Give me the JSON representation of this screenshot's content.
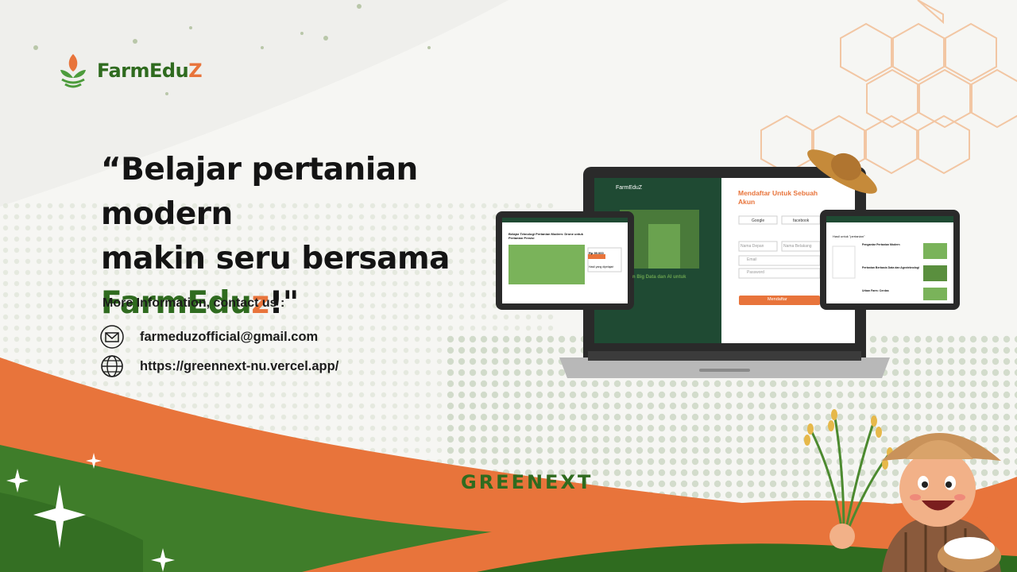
{
  "brand": {
    "name_main": "FarmEdu",
    "name_accent": "Z",
    "footer": "GREENEXT",
    "colors": {
      "green": "#2f6b1f",
      "orange": "#e8743b",
      "dark_green": "#1f4a33"
    }
  },
  "headline": {
    "open_quote": "“",
    "line1": "Belajar pertanian modern",
    "line2": "makin seru bersama",
    "brand_part1": "FarmEdu",
    "brand_part2": "z",
    "close": "!\""
  },
  "contact": {
    "title": "More Information, contact us :",
    "email": "farmeduzofficial@gmail.com",
    "website": "https://greennext-nu.vercel.app/",
    "email_icon": "mail-icon",
    "web_icon": "globe-icon"
  },
  "laptop_screen": {
    "logo": "FarmEduZ",
    "form_title": "Mendaftar Untuk Sebuah Akun",
    "google_btn": "Google",
    "facebook_btn": "facebook",
    "first_name_ph": "Nama Depan",
    "last_name_ph": "Nama Belakang",
    "email_ph": "Email",
    "password_ph": "Password",
    "submit_btn": "Mendaftar",
    "hero_caption": "n Big Data dan AI untuk"
  },
  "left_tablet": {
    "title": "Belajar Teknologi Pertanian Modern: Drone untuk Pertanian Presisi",
    "price": "Rp 99.000",
    "section": "Hasil yang dipelajari"
  },
  "right_tablet": {
    "search_result": "Hasil untuk \"pertanian\"",
    "item1": "Pengantar Pertanian Modern",
    "item2": "Pertanian Berbasis Data dan Agroteknologi",
    "item3": "Urban Farm: Cerdas"
  }
}
